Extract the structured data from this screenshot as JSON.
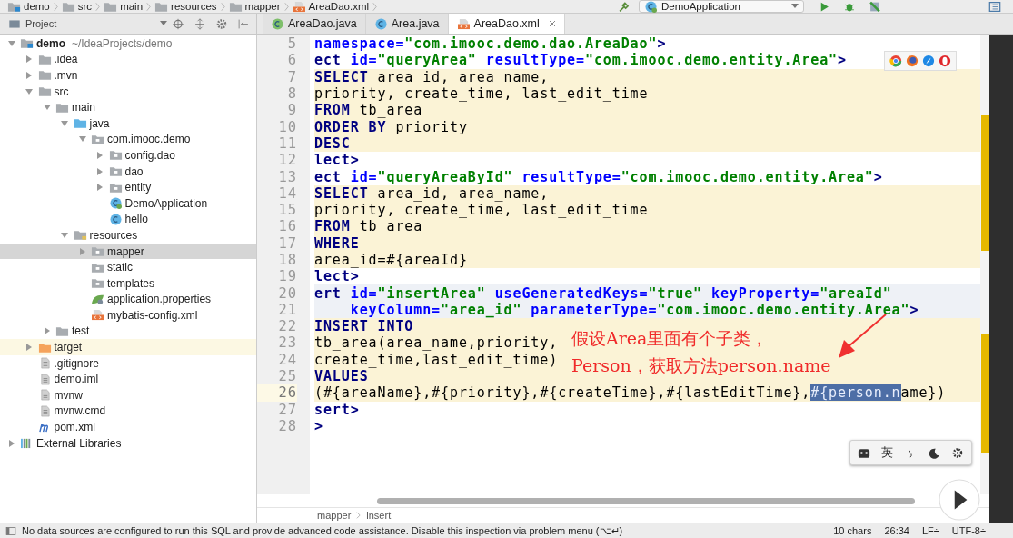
{
  "navigation_bar": {
    "breadcrumbs": [
      {
        "label": "demo",
        "kind": "module"
      },
      {
        "label": "src",
        "kind": "folder"
      },
      {
        "label": "main",
        "kind": "folder"
      },
      {
        "label": "resources",
        "kind": "folder"
      },
      {
        "label": "mapper",
        "kind": "folder"
      },
      {
        "label": "AreaDao.xml",
        "kind": "xml"
      }
    ],
    "run_configuration": "DemoApplication"
  },
  "project_panel": {
    "title": "Project",
    "tree": [
      {
        "label": "demo",
        "path": "~/IdeaProjects/demo",
        "kind": "module",
        "expanded": true,
        "selected": false,
        "highlighted": false,
        "children": [
          {
            "label": ".idea",
            "kind": "folder",
            "expanded": false,
            "selected": false,
            "highlighted": false
          },
          {
            "label": ".mvn",
            "kind": "folder",
            "expanded": false,
            "selected": false,
            "highlighted": false
          },
          {
            "label": "src",
            "kind": "folder",
            "expanded": true,
            "selected": false,
            "highlighted": false,
            "children": [
              {
                "label": "main",
                "kind": "folder",
                "expanded": true,
                "selected": false,
                "highlighted": false,
                "children": [
                  {
                    "label": "java",
                    "kind": "source",
                    "expanded": true,
                    "selected": false,
                    "highlighted": false,
                    "children": [
                      {
                        "label": "com.imooc.demo",
                        "kind": "package",
                        "expanded": true,
                        "selected": false,
                        "highlighted": false,
                        "children": [
                          {
                            "label": "config.dao",
                            "kind": "package",
                            "expanded": false,
                            "selected": false,
                            "highlighted": false
                          },
                          {
                            "label": "dao",
                            "kind": "package",
                            "expanded": false,
                            "selected": false,
                            "highlighted": false
                          },
                          {
                            "label": "entity",
                            "kind": "package",
                            "expanded": false,
                            "selected": false,
                            "highlighted": false
                          },
                          {
                            "label": "DemoApplication",
                            "kind": "spring-class",
                            "selected": false,
                            "highlighted": false
                          },
                          {
                            "label": "hello",
                            "kind": "class",
                            "selected": false,
                            "highlighted": false
                          }
                        ]
                      }
                    ]
                  },
                  {
                    "label": "resources",
                    "kind": "resources",
                    "expanded": true,
                    "selected": false,
                    "highlighted": false,
                    "children": [
                      {
                        "label": "mapper",
                        "kind": "package",
                        "expanded": false,
                        "selected": true,
                        "highlighted": false
                      },
                      {
                        "label": "static",
                        "kind": "package",
                        "selected": false,
                        "highlighted": false
                      },
                      {
                        "label": "templates",
                        "kind": "package",
                        "selected": false,
                        "highlighted": false
                      },
                      {
                        "label": "application.properties",
                        "kind": "properties",
                        "selected": false,
                        "highlighted": false
                      },
                      {
                        "label": "mybatis-config.xml",
                        "kind": "xml",
                        "selected": false,
                        "highlighted": false
                      }
                    ]
                  }
                ]
              },
              {
                "label": "test",
                "kind": "folder",
                "expanded": false,
                "selected": false,
                "highlighted": false
              }
            ]
          },
          {
            "label": "target",
            "kind": "excluded",
            "expanded": false,
            "selected": false,
            "highlighted": true
          },
          {
            "label": ".gitignore",
            "kind": "file",
            "selected": false,
            "highlighted": false
          },
          {
            "label": "demo.iml",
            "kind": "file",
            "selected": false,
            "highlighted": false
          },
          {
            "label": "mvnw",
            "kind": "file",
            "selected": false,
            "highlighted": false
          },
          {
            "label": "mvnw.cmd",
            "kind": "file",
            "selected": false,
            "highlighted": false
          },
          {
            "label": "pom.xml",
            "kind": "maven",
            "selected": false,
            "highlighted": false
          }
        ]
      },
      {
        "label": "External Libraries",
        "kind": "libraries",
        "expanded": false,
        "selected": false,
        "highlighted": false
      }
    ]
  },
  "tabs": [
    {
      "label": "AreaDao.java",
      "kind": "interface",
      "selected": false
    },
    {
      "label": "Area.java",
      "kind": "class",
      "selected": false
    },
    {
      "label": "AreaDao.xml",
      "kind": "xml",
      "selected": true
    }
  ],
  "editor": {
    "lines": [
      {
        "number": "5",
        "kind": "plain",
        "current": false,
        "tokens": [
          {
            "kind": "attr",
            "text": "namespace="
          },
          {
            "kind": "value",
            "text": "\"com.imooc.demo.dao.AreaDao\""
          },
          {
            "kind": "tag",
            "text": ">"
          }
        ]
      },
      {
        "number": "6",
        "kind": "plain",
        "current": false,
        "tokens": [
          {
            "kind": "tag",
            "text": "ect"
          },
          {
            "kind": "attr",
            "text": " id="
          },
          {
            "kind": "value",
            "text": "\"queryArea\""
          },
          {
            "kind": "attr",
            "text": " resultType="
          },
          {
            "kind": "value",
            "text": "\"com.imooc.demo.entity.Area\""
          },
          {
            "kind": "tag",
            "text": ">"
          }
        ]
      },
      {
        "number": "7",
        "kind": "sql",
        "current": false,
        "tokens": [
          {
            "kind": "keyword",
            "text": "SELECT"
          },
          {
            "kind": "plain",
            "text": " area_id, area_name,"
          }
        ]
      },
      {
        "number": "8",
        "kind": "sql",
        "current": false,
        "tokens": [
          {
            "kind": "plain",
            "text": "priority, create_time, last_edit_time"
          }
        ]
      },
      {
        "number": "9",
        "kind": "sql",
        "current": false,
        "tokens": [
          {
            "kind": "keyword",
            "text": "FROM"
          },
          {
            "kind": "plain",
            "text": " tb_area"
          }
        ]
      },
      {
        "number": "10",
        "kind": "sql",
        "current": false,
        "tokens": [
          {
            "kind": "keyword",
            "text": "ORDER BY"
          },
          {
            "kind": "plain",
            "text": " priority"
          }
        ]
      },
      {
        "number": "11",
        "kind": "sql",
        "current": false,
        "tokens": [
          {
            "kind": "keyword",
            "text": "DESC"
          }
        ]
      },
      {
        "number": "12",
        "kind": "plain",
        "current": false,
        "tokens": [
          {
            "kind": "tag",
            "text": "lect>"
          }
        ]
      },
      {
        "number": "13",
        "kind": "plain",
        "current": false,
        "tokens": [
          {
            "kind": "tag",
            "text": "ect"
          },
          {
            "kind": "attr",
            "text": " id="
          },
          {
            "kind": "value",
            "text": "\"queryAreaById\""
          },
          {
            "kind": "attr",
            "text": " resultType="
          },
          {
            "kind": "value",
            "text": "\"com.imooc.demo.entity.Area\""
          },
          {
            "kind": "tag",
            "text": ">"
          }
        ]
      },
      {
        "number": "14",
        "kind": "sql",
        "current": false,
        "tokens": [
          {
            "kind": "keyword",
            "text": "SELECT"
          },
          {
            "kind": "plain",
            "text": " area_id, area_name,"
          }
        ]
      },
      {
        "number": "15",
        "kind": "sql",
        "current": false,
        "tokens": [
          {
            "kind": "plain",
            "text": "priority, create_time, last_edit_time"
          }
        ]
      },
      {
        "number": "16",
        "kind": "sql",
        "current": false,
        "tokens": [
          {
            "kind": "keyword",
            "text": "FROM"
          },
          {
            "kind": "plain",
            "text": " tb_area"
          }
        ]
      },
      {
        "number": "17",
        "kind": "sql",
        "current": false,
        "tokens": [
          {
            "kind": "keyword",
            "text": "WHERE"
          }
        ]
      },
      {
        "number": "18",
        "kind": "sql",
        "current": false,
        "tokens": [
          {
            "kind": "plain",
            "text": "area_id=#{areaId}"
          }
        ]
      },
      {
        "number": "19",
        "kind": "plain",
        "current": false,
        "tokens": [
          {
            "kind": "tag",
            "text": "lect>"
          }
        ]
      },
      {
        "number": "20",
        "kind": "tag",
        "current": false,
        "tokens": [
          {
            "kind": "tag",
            "text": "ert"
          },
          {
            "kind": "attr",
            "text": " id="
          },
          {
            "kind": "value",
            "text": "\"insertArea\""
          },
          {
            "kind": "attr",
            "text": " useGeneratedKeys="
          },
          {
            "kind": "value",
            "text": "\"true\""
          },
          {
            "kind": "attr",
            "text": " keyProperty="
          },
          {
            "kind": "value",
            "text": "\"areaId\""
          }
        ]
      },
      {
        "number": "21",
        "kind": "tag",
        "current": false,
        "tokens": [
          {
            "kind": "attr",
            "text": "    keyColumn="
          },
          {
            "kind": "value",
            "text": "\"area_id\""
          },
          {
            "kind": "attr",
            "text": " parameterType="
          },
          {
            "kind": "value",
            "text": "\"com.imooc.demo.entity.Area\""
          },
          {
            "kind": "tag",
            "text": ">"
          }
        ]
      },
      {
        "number": "22",
        "kind": "sql",
        "current": false,
        "tokens": [
          {
            "kind": "keyword",
            "text": "INSERT INTO"
          }
        ]
      },
      {
        "number": "23",
        "kind": "sql",
        "current": false,
        "tokens": [
          {
            "kind": "plain",
            "text": "tb_area(area_name,priority,"
          }
        ]
      },
      {
        "number": "24",
        "kind": "sql",
        "current": false,
        "tokens": [
          {
            "kind": "plain",
            "text": "create_time,last_edit_time)"
          }
        ]
      },
      {
        "number": "25",
        "kind": "sql",
        "current": false,
        "tokens": [
          {
            "kind": "keyword",
            "text": "VALUES"
          }
        ]
      },
      {
        "number": "26",
        "kind": "sql",
        "current": true,
        "tokens": [
          {
            "kind": "plain",
            "text": "(#{areaName},#{priority},#{createTime},#{lastEditTime},"
          },
          {
            "kind": "selected",
            "text": "#{person.n"
          },
          {
            "kind": "plain",
            "text": "ame})"
          }
        ]
      },
      {
        "number": "27",
        "kind": "plain",
        "current": false,
        "tokens": [
          {
            "kind": "tag",
            "text": "sert>"
          }
        ]
      },
      {
        "number": "28",
        "kind": "plain",
        "current": false,
        "tokens": [
          {
            "kind": "tag",
            "text": ">"
          }
        ]
      }
    ],
    "breadcrumbs": [
      "mapper",
      "insert"
    ],
    "annotation": [
      "假设Area里面有个子类，",
      "Person，获取方法person.name"
    ],
    "input_method": "英"
  },
  "status_bar": {
    "message": "No data sources are configured to run this SQL and provide advanced code assistance. Disable this inspection via problem menu (⌥↵)",
    "items": [
      "10 chars",
      "26:34",
      "LF÷",
      "UTF-8÷"
    ]
  }
}
